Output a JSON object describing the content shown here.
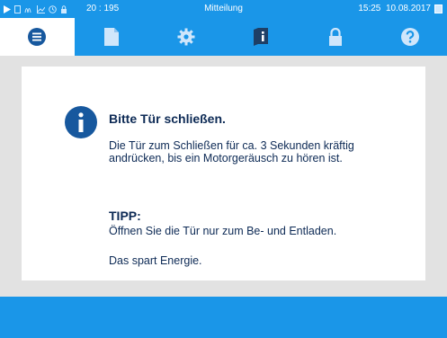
{
  "status_bar": {
    "icons": [
      "play-icon",
      "document-icon",
      "waves-icon",
      "chart-icon",
      "clock-icon",
      "lock-icon"
    ],
    "counter": "20 : 195",
    "title": "Mitteilung",
    "time": "15:25",
    "date": "10.08.2017",
    "accent": "#1a96e8"
  },
  "tabs": [
    {
      "icon": "menu-list-icon",
      "active": true
    },
    {
      "icon": "document-icon",
      "active": false
    },
    {
      "icon": "gear-icon",
      "active": false
    },
    {
      "icon": "info-book-icon",
      "active": false
    },
    {
      "icon": "lock-icon",
      "active": false
    },
    {
      "icon": "help-icon",
      "active": false
    }
  ],
  "message": {
    "icon": "info-icon",
    "title": "Bitte Tür schließen.",
    "body": "Die Tür zum Schließen für ca. 3 Sekunden kräftig andrücken, bis ein Motorgeräusch zu hören ist.",
    "tip_title": "TIPP:",
    "tip_text": "Öffnen Sie die Tür nur zum Be- und Entladen.",
    "tip_note": "Das spart Energie."
  },
  "colors": {
    "accent": "#1a96e8",
    "icon_dark": "#17589e",
    "text": "#0d2a55",
    "background": "#e2e2e2"
  }
}
